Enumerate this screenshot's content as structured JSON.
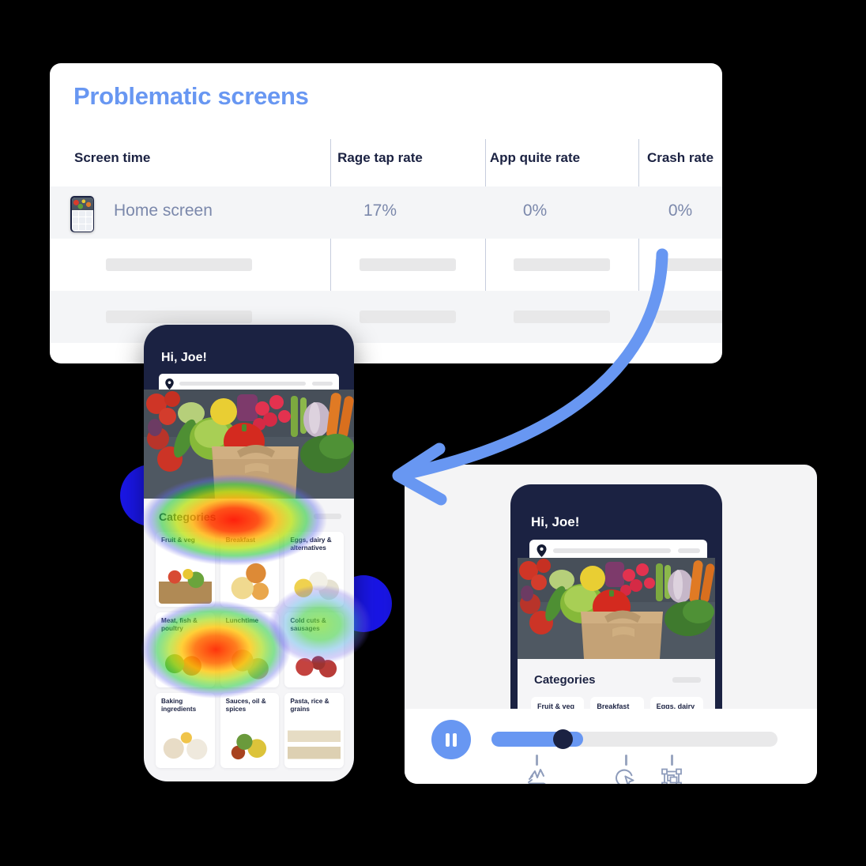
{
  "card": {
    "title": "Problematic screens",
    "table": {
      "columns": [
        "Screen time",
        "Rage tap rate",
        "App quite rate",
        "Crash rate"
      ],
      "rows": [
        {
          "screen": "Home screen",
          "rage_tap_rate": "17%",
          "app_quite_rate": "0%",
          "crash_rate": "0%",
          "placeholder": false
        },
        {
          "screen": "",
          "rage_tap_rate": "",
          "app_quite_rate": "",
          "crash_rate": "",
          "placeholder": true
        },
        {
          "screen": "",
          "rage_tap_rate": "",
          "app_quite_rate": "",
          "crash_rate": "",
          "placeholder": true
        }
      ]
    }
  },
  "phone_heatmap": {
    "greeting": "Hi, Joe!",
    "search_placeholder": "",
    "location_icon": "map-pin-icon",
    "categories_title": "Categories",
    "categories": [
      "Fruit & veg",
      "Breakfast",
      "Eggs, dairy & alternatives",
      "Meat, fish & poultry",
      "Lunchtime",
      "Cold cuts & sausages",
      "Baking ingredients",
      "Sauces, oil & spices",
      "Pasta, rice & grains"
    ]
  },
  "phone_replay": {
    "greeting": "Hi, Joe!",
    "location_icon": "map-pin-icon",
    "categories_title": "Categories",
    "categories": [
      "Fruit & veg",
      "Breakfast",
      "Eggs, dairy &"
    ]
  },
  "player": {
    "play_state": "playing",
    "play_button_icon": "pause-icon",
    "progress_percent": 25,
    "buffered_percent": 32,
    "event_markers": [
      {
        "icon": "rage-tap-icon",
        "position_percent": 16
      },
      {
        "icon": "dead-click-icon",
        "position_percent": 47
      },
      {
        "icon": "screen-change-icon",
        "position_percent": 63
      }
    ]
  },
  "annotation": {
    "arrow_icon": "curved-arrow-icon"
  },
  "colors": {
    "accent_blue": "#6897f2",
    "navy": "#1b2242",
    "muted_text": "#7b88ab",
    "panel_bg": "#f4f4f5",
    "row_alt": "#f4f5f7",
    "blob_blue": "#1a16e8"
  }
}
